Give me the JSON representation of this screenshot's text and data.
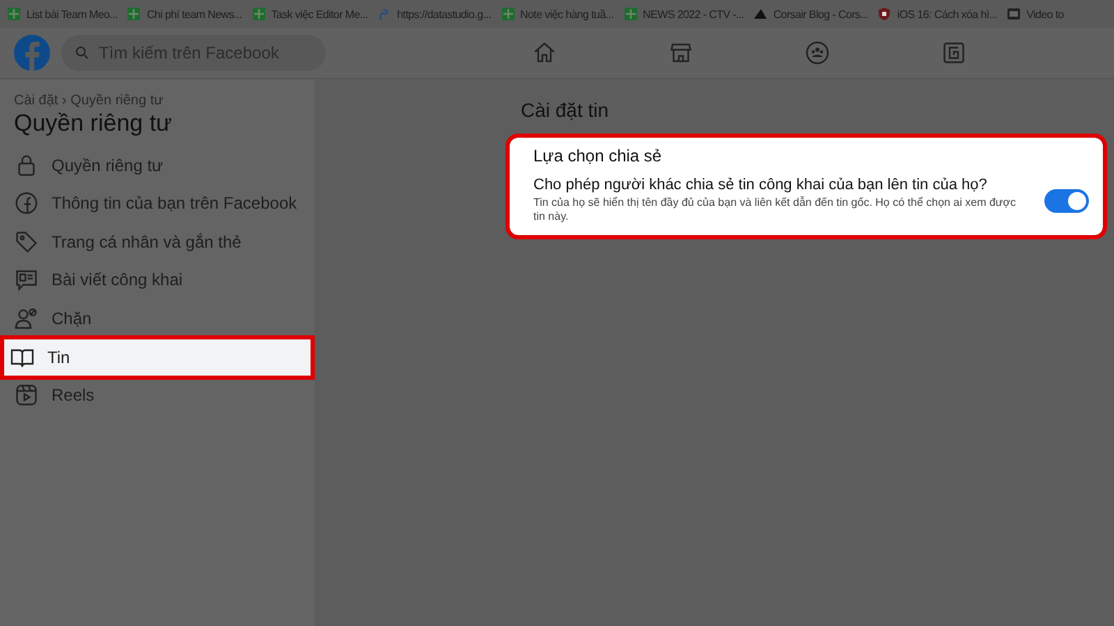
{
  "bookmarks": [
    {
      "label": "List bài Team Meo..."
    },
    {
      "label": "Chi phí team News..."
    },
    {
      "label": "Task việc Editor Me..."
    },
    {
      "label": "https://datastudio.g..."
    },
    {
      "label": "Note việc hàng tuầ..."
    },
    {
      "label": "NEWS 2022 - CTV -..."
    },
    {
      "label": "Corsair Blog - Cors..."
    },
    {
      "label": "iOS 16: Cách xóa hì..."
    },
    {
      "label": "Video to"
    }
  ],
  "topbar": {
    "search": {
      "placeholder": "Tìm kiếm trên Facebook"
    }
  },
  "sidebar": {
    "breadcrumb": "Cài đặt › Quyền riêng tư",
    "title": "Quyền riêng tư",
    "items": [
      {
        "label": "Quyền riêng tư",
        "selected": false,
        "highlighted": false
      },
      {
        "label": "Thông tin của bạn trên Facebook",
        "selected": false,
        "highlighted": false
      },
      {
        "label": "Trang cá nhân và gắn thẻ",
        "selected": false,
        "highlighted": false
      },
      {
        "label": "Bài viết công khai",
        "selected": false,
        "highlighted": false
      },
      {
        "label": "Chặn",
        "selected": false,
        "highlighted": false
      },
      {
        "label": "Tin",
        "selected": true,
        "highlighted": true
      },
      {
        "label": "Reels",
        "selected": false,
        "highlighted": false
      }
    ]
  },
  "main": {
    "heading": "Cài đặt tin",
    "card": {
      "title": "Lựa chọn chia sẻ",
      "highlighted": true,
      "setting": {
        "label": "Cho phép người khác chia sẻ tin công khai của bạn lên tin của họ?",
        "description": "Tin của họ sẽ hiển thị tên đầy đủ của bạn và liên kết dẫn đến tin gốc. Họ có thể chọn ai xem được tin này.",
        "on": true
      }
    }
  }
}
